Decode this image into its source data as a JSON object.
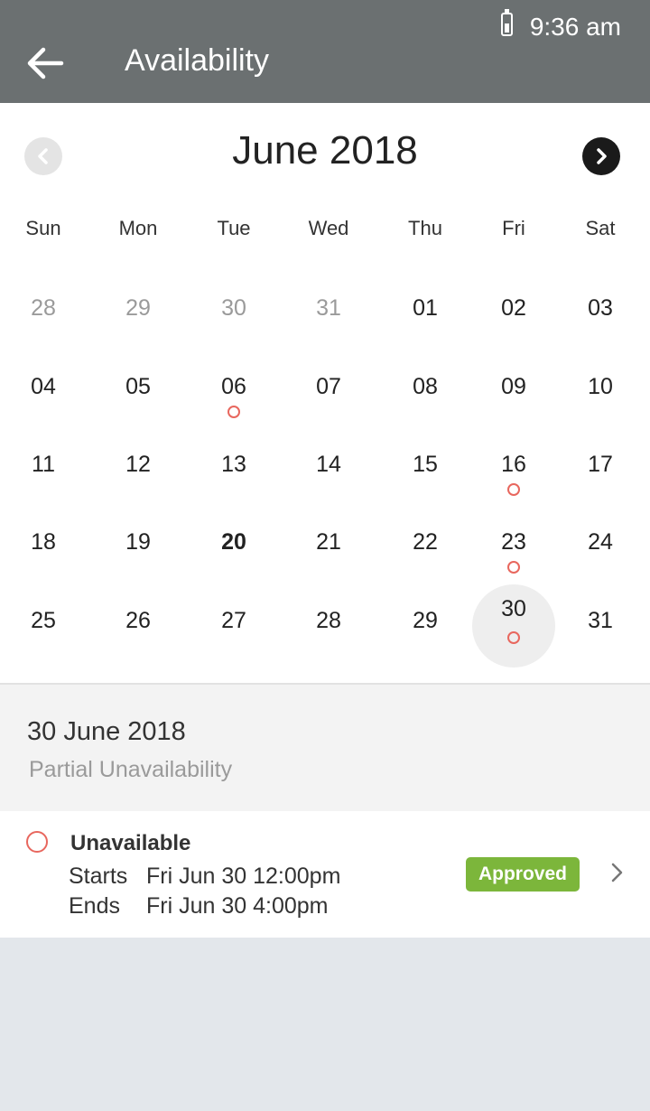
{
  "status_bar": {
    "time": "9:36 am",
    "battery_icon": "battery-icon"
  },
  "app_bar": {
    "title": "Availability",
    "back_icon": "arrow-left-icon"
  },
  "calendar": {
    "month_title": "June 2018",
    "prev_icon": "chevron-left-circle-icon",
    "next_icon": "chevron-right-circle-icon",
    "weekdays": [
      "Sun",
      "Mon",
      "Tue",
      "Wed",
      "Thu",
      "Fri",
      "Sat"
    ],
    "weeks": [
      [
        {
          "day": "28",
          "muted": true
        },
        {
          "day": "29",
          "muted": true
        },
        {
          "day": "30",
          "muted": true
        },
        {
          "day": "31",
          "muted": true
        },
        {
          "day": "01"
        },
        {
          "day": "02"
        },
        {
          "day": "03"
        }
      ],
      [
        {
          "day": "04"
        },
        {
          "day": "05"
        },
        {
          "day": "06",
          "marker": true
        },
        {
          "day": "07"
        },
        {
          "day": "08"
        },
        {
          "day": "09"
        },
        {
          "day": "10"
        }
      ],
      [
        {
          "day": "11"
        },
        {
          "day": "12"
        },
        {
          "day": "13"
        },
        {
          "day": "14"
        },
        {
          "day": "15"
        },
        {
          "day": "16",
          "marker": true
        },
        {
          "day": "17"
        }
      ],
      [
        {
          "day": "18"
        },
        {
          "day": "19"
        },
        {
          "day": "20",
          "today": true
        },
        {
          "day": "21"
        },
        {
          "day": "22"
        },
        {
          "day": "23",
          "marker": true
        },
        {
          "day": "24"
        }
      ],
      [
        {
          "day": "25"
        },
        {
          "day": "26"
        },
        {
          "day": "27"
        },
        {
          "day": "28"
        },
        {
          "day": "29"
        },
        {
          "day": "30",
          "marker": true,
          "selected": true
        },
        {
          "day": "31"
        }
      ]
    ],
    "marker_color": "#e8675e"
  },
  "summary": {
    "date": "30 June 2018",
    "subtitle": "Partial Unavailability"
  },
  "event": {
    "title": "Unavailable",
    "starts_label": "Starts",
    "starts_value": "Fri Jun 30 12:00pm",
    "ends_label": "Ends",
    "ends_value": "Fri Jun 30 4:00pm",
    "status": "Approved",
    "status_color": "#7cb63b",
    "chevron_icon": "chevron-right-icon"
  }
}
